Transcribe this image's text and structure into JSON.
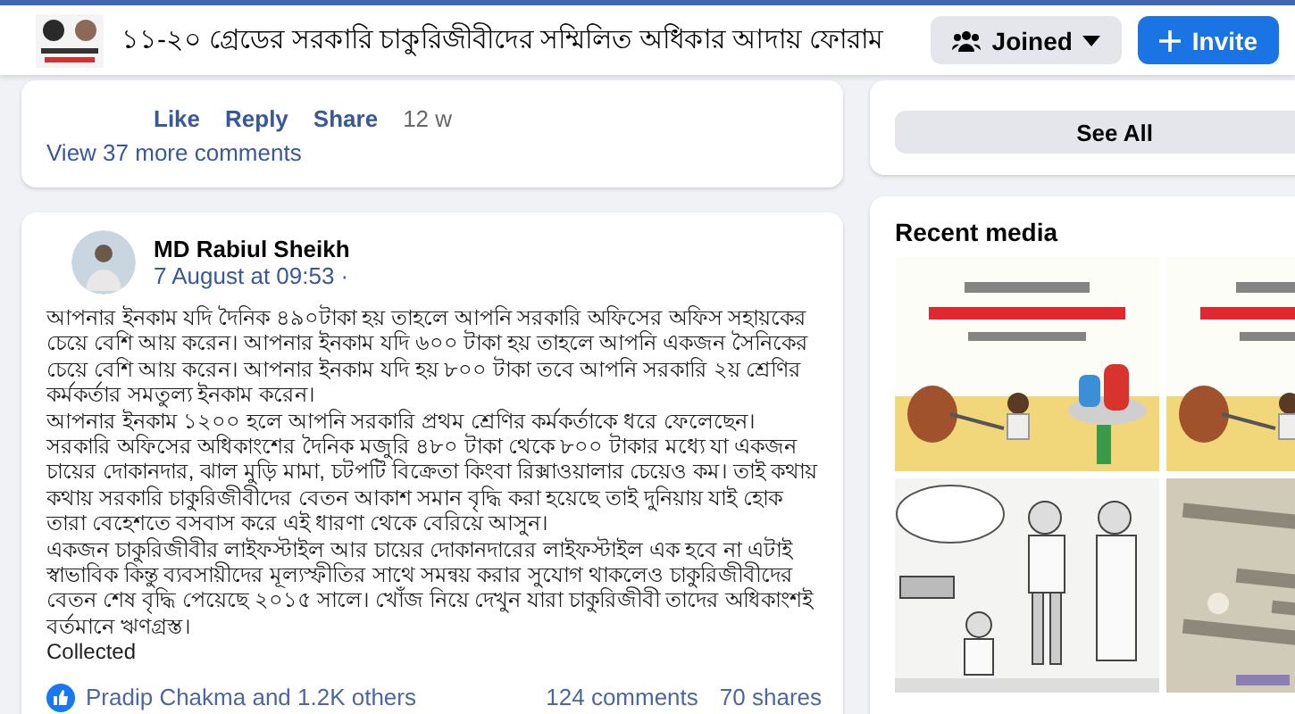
{
  "header": {
    "group_title": "১১-২০ গ্রেডের সরকারি চাকুরিজীবীদের সম্মিলিত অধিকার আদায় ফোরাম",
    "buttons": [
      {
        "kind": "joined",
        "label": "Joined"
      },
      {
        "kind": "invite",
        "label": "Invite"
      }
    ]
  },
  "comment_card": {
    "actions": [
      "Like",
      "Reply",
      "Share"
    ],
    "time": "12 w",
    "more": "View 37 more comments"
  },
  "side_card": {
    "button": "See All"
  },
  "post": {
    "author": "MD Rabiul Sheikh",
    "timestamp": "7 August at 09:53 ·",
    "paragraphs": [
      "আপনার ইনকাম যদি দৈনিক ৪৯০টাকা হয় তাহলে আপনি সরকারি অফিসের অফিস সহায়কের চেয়ে বেশি আয় করেন। আপনার ইনকাম যদি ৬০০ টাকা হয় তাহলে আপনি একজন সৈনিকের চেয়ে বেশি আয় করেন। আপনার ইনকাম যদি হয় ৮০০ টাকা তবে আপনি সরকারি ২য় শ্রেণির কর্মকর্তার সমতুল্য ইনকাম করেন।",
      "আপনার ইনকাম ১২০০ হলে আপনি সরকারি প্রথম শ্রেণির কর্মকর্তাকে ধরে ফেলেছেন।",
      "সরকারি অফিসের অধিকাংশের দৈনিক মজুরি ৪৮০ টাকা থেকে ৮০০ টাকার মধ্যে যা একজন চায়ের দোকানদার, ঝাল মুড়ি মামা, চটপটি বিক্রেতা কিংবা রিক্সাওয়ালার চেয়েও কম। তাই কথায় কথায় সরকারি চাকুরিজীবীদের বেতন আকাশ সমান বৃদ্ধি করা হয়েছে তাই দুনিয়ায় যাই হোক তারা বেহেশতে বসবাস করে এই ধারণা থেকে বেরিয়ে আসুন।",
      "একজন চাকুরিজীবীর লাইফস্টাইল আর চায়ের দোকানদারের লাইফস্টাইল এক হবে না এটাই স্বাভাবিক কিন্তু ব্যবসায়ীদের মূল্যস্ফীতির সাথে সমন্বয় করার সুযোগ থাকলেও চাকুরিজীবীদের বেতন শেষ বৃদ্ধি পেয়েছে ২০১৫ সালে।  খোঁজ নিয়ে দেখুন যারা চাকুরিজীবী তাদের অধিকাংশই বর্তমানে ঋণগ্রস্ত।",
      "Collected"
    ],
    "reactions": "Pradip Chakma and 1.2K others",
    "comments": "124 comments",
    "shares": "70 shares"
  },
  "recent_media": {
    "title": "Recent media"
  }
}
